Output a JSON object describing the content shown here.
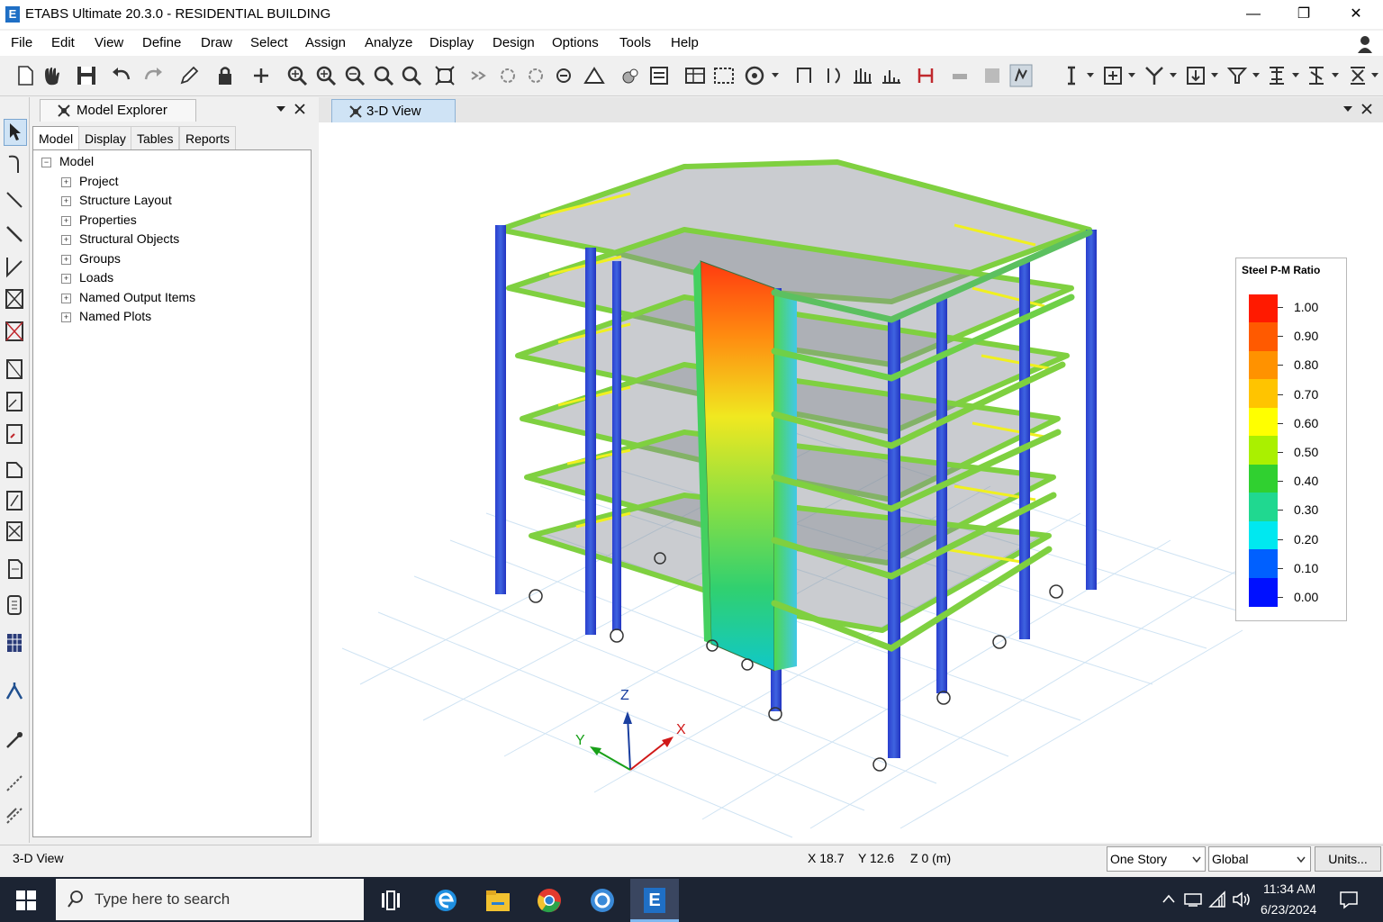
{
  "window": {
    "app_icon_letter": "E",
    "title": "ETABS Ultimate 20.3.0 - RESIDENTIAL BUILDING",
    "minimize": "—",
    "maximize": "❐",
    "close": "✕"
  },
  "menu": [
    "File",
    "Edit",
    "View",
    "Define",
    "Draw",
    "Select",
    "Assign",
    "Analyze",
    "Display",
    "Design",
    "Options",
    "Tools",
    "Help"
  ],
  "explorer": {
    "title": "Model Explorer",
    "tabs": [
      "Model",
      "Display",
      "Tables",
      "Reports"
    ],
    "root": "Model",
    "items": [
      "Project",
      "Structure Layout",
      "Properties",
      "Structural Objects",
      "Groups",
      "Loads",
      "Named Output Items",
      "Named Plots"
    ]
  },
  "view": {
    "tab_label": "3-D View",
    "axes": {
      "x": "X",
      "y": "Y",
      "z": "Z"
    }
  },
  "legend": {
    "title": "Steel P-M Ratio",
    "labels": [
      "1.00",
      "0.90",
      "0.80",
      "0.70",
      "0.60",
      "0.50",
      "0.40",
      "0.30",
      "0.20",
      "0.10",
      "0.00"
    ],
    "colors": [
      "#ff1a00",
      "#ff5a00",
      "#ff9200",
      "#ffc400",
      "#ffff00",
      "#aaf000",
      "#30d030",
      "#20d890",
      "#00e8f0",
      "#0060ff",
      "#0010ff"
    ]
  },
  "status": {
    "view_name": "3-D View",
    "x": "X 18.7",
    "y": "Y 12.6",
    "z": "Z 0 (m)",
    "story": "One Story",
    "coord_system": "Global",
    "units_button": "Units..."
  },
  "taskbar": {
    "search_placeholder": "Type here to search",
    "time": "11:34 AM",
    "date": "6/23/2024",
    "etabs_letter": "E"
  },
  "colors": {
    "accent": "#1f6fc5",
    "taskbar": "#1c2433",
    "column_blue": "#3a4fd0",
    "beam_green": "#6fd04a"
  }
}
